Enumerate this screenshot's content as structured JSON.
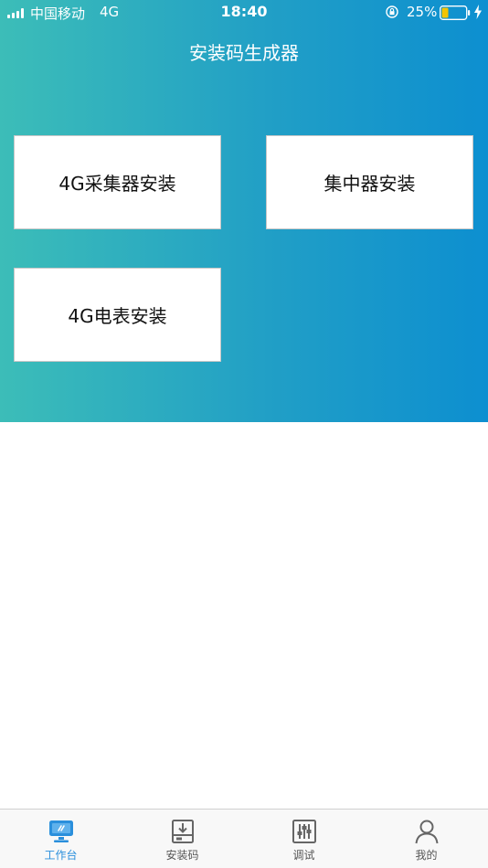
{
  "status_bar": {
    "carrier": "中国移动",
    "network": "4G",
    "time": "18:40",
    "battery_percent": "25%",
    "icons": [
      "signal-icon",
      "rotation-lock-icon",
      "battery-icon",
      "charging-icon"
    ]
  },
  "header": {
    "title": "安装码生成器"
  },
  "cards": [
    {
      "label": "4G采集器安装"
    },
    {
      "label": "集中器安装"
    },
    {
      "label": "4G电表安装"
    }
  ],
  "tab_bar": {
    "tabs": [
      {
        "label": "工作台",
        "icon": "monitor-icon",
        "active": true
      },
      {
        "label": "安装码",
        "icon": "download-box-icon",
        "active": false
      },
      {
        "label": "调试",
        "icon": "sliders-icon",
        "active": false
      },
      {
        "label": "我的",
        "icon": "person-icon",
        "active": false
      }
    ]
  },
  "colors": {
    "gradient_start": "#3cbdb8",
    "gradient_end": "#0d8fd0",
    "active_tab": "#2a8fdc",
    "inactive_tab": "#555555",
    "battery_level": "#f5c400"
  }
}
